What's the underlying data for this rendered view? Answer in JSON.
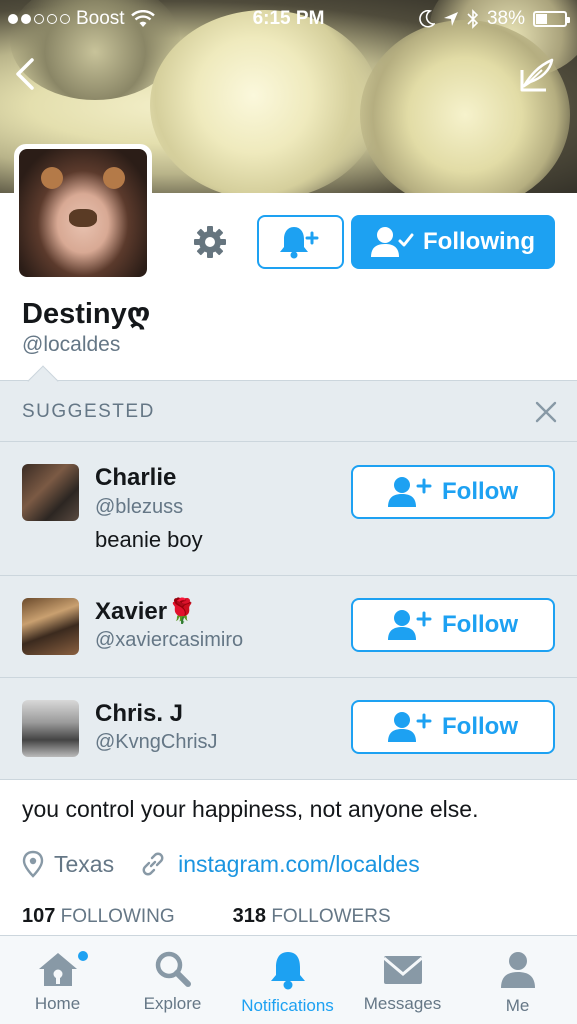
{
  "status_bar": {
    "carrier": "Boost",
    "time": "6:15 PM",
    "battery": "38%",
    "battery_level": 0.38
  },
  "profile": {
    "name": "Destinyღ",
    "handle": "@localdes",
    "following_button": "Following",
    "bio": "you control your happiness, not anyone else.",
    "location": "Texas",
    "website": "instagram.com/localdes",
    "following_count": "107",
    "following_label": "FOLLOWING",
    "followers_count": "318",
    "followers_label": "FOLLOWERS"
  },
  "suggested": {
    "header": "SUGGESTED",
    "users": [
      {
        "name": "Charlie",
        "handle": "@blezuss",
        "bio": "beanie boy",
        "button": "Follow"
      },
      {
        "name": "Xavier🌹",
        "handle": "@xaviercasimiro",
        "bio": "",
        "button": "Follow"
      },
      {
        "name": "Chris. J",
        "handle": "@KvngChrisJ",
        "bio": "",
        "button": "Follow"
      }
    ]
  },
  "tabs": [
    {
      "label": "Home",
      "icon": "home-icon",
      "active": false
    },
    {
      "label": "Explore",
      "icon": "search-icon",
      "active": false
    },
    {
      "label": "Notifications",
      "icon": "bell-icon",
      "active": true
    },
    {
      "label": "Messages",
      "icon": "envelope-icon",
      "active": false
    },
    {
      "label": "Me",
      "icon": "person-icon",
      "active": false
    }
  ],
  "colors": {
    "accent": "#1da1f2",
    "link": "#1b95e0",
    "muted": "#657786",
    "suggested_bg": "#e6ecf0"
  }
}
